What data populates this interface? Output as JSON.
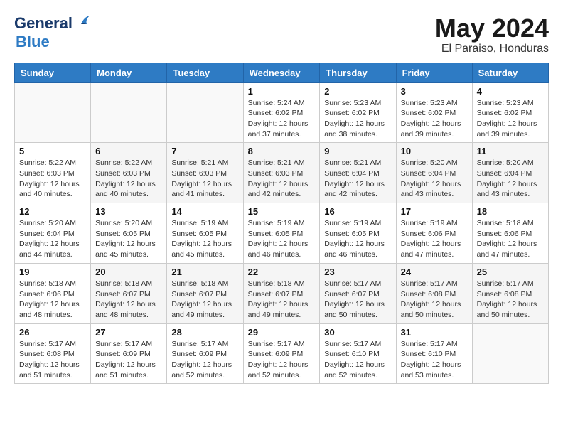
{
  "logo": {
    "part1": "General",
    "part2": "Blue"
  },
  "title": "May 2024",
  "subtitle": "El Paraiso, Honduras",
  "days_of_week": [
    "Sunday",
    "Monday",
    "Tuesday",
    "Wednesday",
    "Thursday",
    "Friday",
    "Saturday"
  ],
  "weeks": [
    [
      {
        "day": "",
        "info": ""
      },
      {
        "day": "",
        "info": ""
      },
      {
        "day": "",
        "info": ""
      },
      {
        "day": "1",
        "info": "Sunrise: 5:24 AM\nSunset: 6:02 PM\nDaylight: 12 hours\nand 37 minutes."
      },
      {
        "day": "2",
        "info": "Sunrise: 5:23 AM\nSunset: 6:02 PM\nDaylight: 12 hours\nand 38 minutes."
      },
      {
        "day": "3",
        "info": "Sunrise: 5:23 AM\nSunset: 6:02 PM\nDaylight: 12 hours\nand 39 minutes."
      },
      {
        "day": "4",
        "info": "Sunrise: 5:23 AM\nSunset: 6:02 PM\nDaylight: 12 hours\nand 39 minutes."
      }
    ],
    [
      {
        "day": "5",
        "info": "Sunrise: 5:22 AM\nSunset: 6:03 PM\nDaylight: 12 hours\nand 40 minutes."
      },
      {
        "day": "6",
        "info": "Sunrise: 5:22 AM\nSunset: 6:03 PM\nDaylight: 12 hours\nand 40 minutes."
      },
      {
        "day": "7",
        "info": "Sunrise: 5:21 AM\nSunset: 6:03 PM\nDaylight: 12 hours\nand 41 minutes."
      },
      {
        "day": "8",
        "info": "Sunrise: 5:21 AM\nSunset: 6:03 PM\nDaylight: 12 hours\nand 42 minutes."
      },
      {
        "day": "9",
        "info": "Sunrise: 5:21 AM\nSunset: 6:04 PM\nDaylight: 12 hours\nand 42 minutes."
      },
      {
        "day": "10",
        "info": "Sunrise: 5:20 AM\nSunset: 6:04 PM\nDaylight: 12 hours\nand 43 minutes."
      },
      {
        "day": "11",
        "info": "Sunrise: 5:20 AM\nSunset: 6:04 PM\nDaylight: 12 hours\nand 43 minutes."
      }
    ],
    [
      {
        "day": "12",
        "info": "Sunrise: 5:20 AM\nSunset: 6:04 PM\nDaylight: 12 hours\nand 44 minutes."
      },
      {
        "day": "13",
        "info": "Sunrise: 5:20 AM\nSunset: 6:05 PM\nDaylight: 12 hours\nand 45 minutes."
      },
      {
        "day": "14",
        "info": "Sunrise: 5:19 AM\nSunset: 6:05 PM\nDaylight: 12 hours\nand 45 minutes."
      },
      {
        "day": "15",
        "info": "Sunrise: 5:19 AM\nSunset: 6:05 PM\nDaylight: 12 hours\nand 46 minutes."
      },
      {
        "day": "16",
        "info": "Sunrise: 5:19 AM\nSunset: 6:05 PM\nDaylight: 12 hours\nand 46 minutes."
      },
      {
        "day": "17",
        "info": "Sunrise: 5:19 AM\nSunset: 6:06 PM\nDaylight: 12 hours\nand 47 minutes."
      },
      {
        "day": "18",
        "info": "Sunrise: 5:18 AM\nSunset: 6:06 PM\nDaylight: 12 hours\nand 47 minutes."
      }
    ],
    [
      {
        "day": "19",
        "info": "Sunrise: 5:18 AM\nSunset: 6:06 PM\nDaylight: 12 hours\nand 48 minutes."
      },
      {
        "day": "20",
        "info": "Sunrise: 5:18 AM\nSunset: 6:07 PM\nDaylight: 12 hours\nand 48 minutes."
      },
      {
        "day": "21",
        "info": "Sunrise: 5:18 AM\nSunset: 6:07 PM\nDaylight: 12 hours\nand 49 minutes."
      },
      {
        "day": "22",
        "info": "Sunrise: 5:18 AM\nSunset: 6:07 PM\nDaylight: 12 hours\nand 49 minutes."
      },
      {
        "day": "23",
        "info": "Sunrise: 5:17 AM\nSunset: 6:07 PM\nDaylight: 12 hours\nand 50 minutes."
      },
      {
        "day": "24",
        "info": "Sunrise: 5:17 AM\nSunset: 6:08 PM\nDaylight: 12 hours\nand 50 minutes."
      },
      {
        "day": "25",
        "info": "Sunrise: 5:17 AM\nSunset: 6:08 PM\nDaylight: 12 hours\nand 50 minutes."
      }
    ],
    [
      {
        "day": "26",
        "info": "Sunrise: 5:17 AM\nSunset: 6:08 PM\nDaylight: 12 hours\nand 51 minutes."
      },
      {
        "day": "27",
        "info": "Sunrise: 5:17 AM\nSunset: 6:09 PM\nDaylight: 12 hours\nand 51 minutes."
      },
      {
        "day": "28",
        "info": "Sunrise: 5:17 AM\nSunset: 6:09 PM\nDaylight: 12 hours\nand 52 minutes."
      },
      {
        "day": "29",
        "info": "Sunrise: 5:17 AM\nSunset: 6:09 PM\nDaylight: 12 hours\nand 52 minutes."
      },
      {
        "day": "30",
        "info": "Sunrise: 5:17 AM\nSunset: 6:10 PM\nDaylight: 12 hours\nand 52 minutes."
      },
      {
        "day": "31",
        "info": "Sunrise: 5:17 AM\nSunset: 6:10 PM\nDaylight: 12 hours\nand 53 minutes."
      },
      {
        "day": "",
        "info": ""
      }
    ]
  ]
}
